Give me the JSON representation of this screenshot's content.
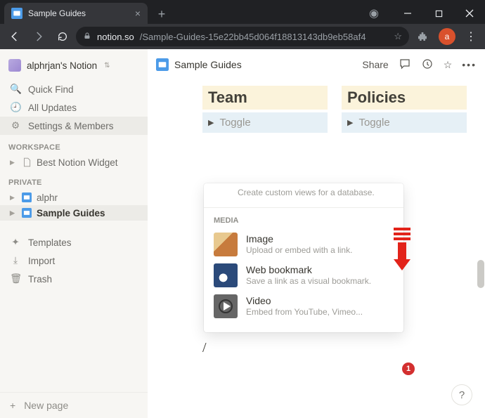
{
  "browser": {
    "tab_title": "Sample Guides",
    "url_host": "notion.so",
    "url_path": "/Sample-Guides-15e22bb45d064f18813143db9eb58af4",
    "profile_letter": "a"
  },
  "sidebar": {
    "workspace_name": "alphrjan's Notion",
    "quick_find": "Quick Find",
    "all_updates": "All Updates",
    "settings": "Settings & Members",
    "section_workspace": "WORKSPACE",
    "section_private": "PRIVATE",
    "workspace_pages": [
      {
        "title": "Best Notion Widget"
      }
    ],
    "private_pages": [
      {
        "title": "alphr"
      },
      {
        "title": "Sample Guides"
      }
    ],
    "templates": "Templates",
    "import": "Import",
    "trash": "Trash",
    "new_page": "New page"
  },
  "topbar": {
    "breadcrumb": "Sample Guides",
    "share": "Share"
  },
  "columns": [
    {
      "heading": "Team",
      "toggle": "Toggle"
    },
    {
      "heading": "Policies",
      "toggle": "Toggle"
    }
  ],
  "popup": {
    "cutoff_desc": "Create custom views for a database.",
    "group_label": "MEDIA",
    "items": [
      {
        "title": "Image",
        "desc": "Upload or embed with a link."
      },
      {
        "title": "Web bookmark",
        "desc": "Save a link as a visual bookmark."
      },
      {
        "title": "Video",
        "desc": "Embed from YouTube, Vimeo..."
      }
    ]
  },
  "annotation_badge": "1",
  "slash_char": "/",
  "help_char": "?"
}
